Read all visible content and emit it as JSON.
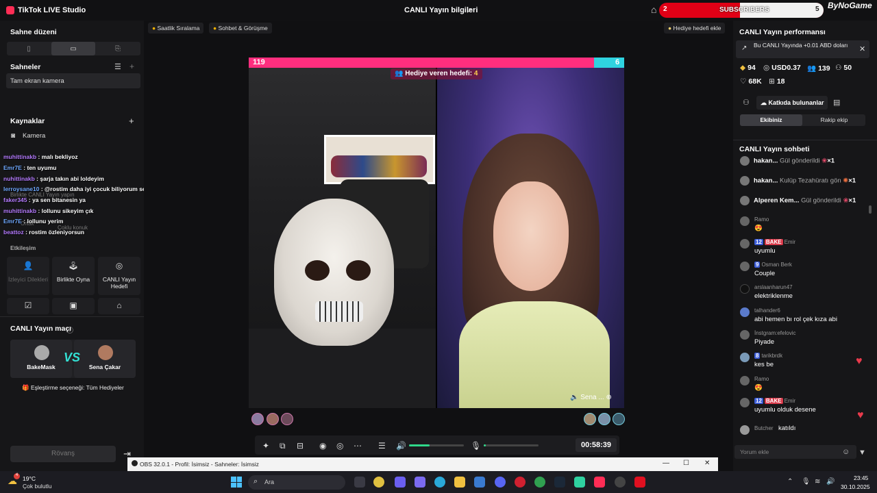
{
  "title_bar": {
    "app_name": "TikTok LIVE Studio",
    "window_title": "CANLI Yayın bilgileri",
    "subscribers_label": "SUBSCRIBERS",
    "subscribers_left": "2",
    "subscribers_right": "5",
    "overlay_brand": "ByNoGame"
  },
  "left_panel": {
    "scene_layout_title": "Sahne düzeni",
    "scenes_title": "Sahneler",
    "scene_item": "Tam ekran kamera",
    "sources_title": "Kaynaklar",
    "source_camera": "Kamera",
    "interaction_title": "Etkileşim",
    "tiles": [
      {
        "label": "İzleyici Dilekleri"
      },
      {
        "label": "Birlikte Oyna"
      },
      {
        "label": "CANLI Yayın Hedefi"
      }
    ],
    "match_title": "CANLI Yayın maçı",
    "match_left": "BakeMask",
    "match_right": "Sena Çakar",
    "match_vs": "VS",
    "pairing_option": "Eşleştirme seçeneği: Tüm Hediyeler",
    "rematch": "Rövanş"
  },
  "overlay_chat": [
    {
      "user": "muhittinakb",
      "text": " : malı bekliyoz"
    },
    {
      "user": "Emr7E",
      "text": " : ten uyumu"
    },
    {
      "user": "nuhittinakb",
      "text": " : şarja takın abi loldeyim"
    },
    {
      "user": "lerroysane10",
      "text": " : @rostim daha iyi çocuk biliyorum sende benim tarafimdasin"
    },
    {
      "user": "faker345",
      "text": " : ya sen bitanesin ya"
    },
    {
      "user": "muhittinakb",
      "text": " : lollunu sikeyim çık"
    },
    {
      "user": "Emr7E",
      "text": " : lollunu yerim"
    },
    {
      "user": "beattoz",
      "text": " : rostim özleniyorsun"
    }
  ],
  "overlay_ghost": {
    "line1": "Birlikte CANLI Yayın yapın",
    "line2": "Ortak",
    "line3": "Çoklu konuk"
  },
  "center": {
    "chip_hourly": "Saatlik Sıralama",
    "chip_chat": "Sohbet & Görüşme",
    "chip_gift_goal": "Hediye hedefi ekle",
    "score_left": "119",
    "score_right": "6",
    "gift_goal_label": "Hediye veren hedefi: ",
    "gift_goal_value": "4",
    "cohost_name": "Sena ...",
    "timer": "00:58:39",
    "volume_level": 0.38,
    "mic_level": 0.04
  },
  "right_panel": {
    "performance_title": "CANLI Yayın performansı",
    "earn_text": "Bu CANLI Yayında +0.01 ABD doları",
    "stats": {
      "diamonds": "94",
      "usd": "USD0.37",
      "viewers": "139",
      "new_followers": "50",
      "likes": "68K",
      "gifts": "18"
    },
    "contributors_button": "Katkıda bulunanlar",
    "team_tabs": [
      "Ekibiniz",
      "Rakip ekip"
    ],
    "chat_title": "CANLI Yayın sohbeti",
    "gifts": [
      {
        "name": "hakan...",
        "action": "Gül gönderildi",
        "count": "×1"
      },
      {
        "name": "hakan...",
        "action": "Kulüp Tezahüratı gön",
        "count": "×1"
      },
      {
        "name": "Alperen Kem...",
        "action": "Gül gönderildi",
        "count": "×1"
      }
    ],
    "messages": [
      {
        "meta": "Ramo",
        "level": "",
        "fan": "",
        "text": "😍"
      },
      {
        "meta": "Emir",
        "level": "12",
        "fan": "BAKE",
        "text": "uyumlu"
      },
      {
        "meta": "Osman Berk",
        "level": "9",
        "fan": "",
        "text": "Couple"
      },
      {
        "meta": "arslaanharun47",
        "level": "",
        "fan": "",
        "text": "elektriklenme"
      },
      {
        "meta": "talhander6",
        "level": "",
        "fan": "",
        "text": "abi hemen bı rol çek kıza abi"
      },
      {
        "meta": "İnstgram:efelovic",
        "level": "",
        "fan": "",
        "text": "Piyade"
      },
      {
        "meta": "tarikbrdk",
        "level": "8",
        "fan": "",
        "text": "kes be"
      },
      {
        "meta": "Ramo",
        "level": "",
        "fan": "",
        "text": "😍"
      },
      {
        "meta": "Emir",
        "level": "12",
        "fan": "BAKE",
        "text": "uyumlu olduk desene"
      },
      {
        "meta": "Butcher",
        "level": "",
        "fan": "",
        "text": "katıldı"
      }
    ],
    "comment_placeholder": "Yorum ekle"
  },
  "obs_bar": {
    "title": "OBS 32.0.1 - Profil: İsimsiz - Sahneler: İsimsiz"
  },
  "taskbar": {
    "temperature": "19°C",
    "weather": "Çok bulutlu",
    "search_placeholder": "Ara",
    "time": "23:45",
    "date": "30.10.2025"
  },
  "colors": {
    "accent_pink": "#ff2e7e",
    "accent_cyan": "#2fd3e0",
    "subscriber_red": "#e00016",
    "level_badge": "#3b5cd6"
  }
}
